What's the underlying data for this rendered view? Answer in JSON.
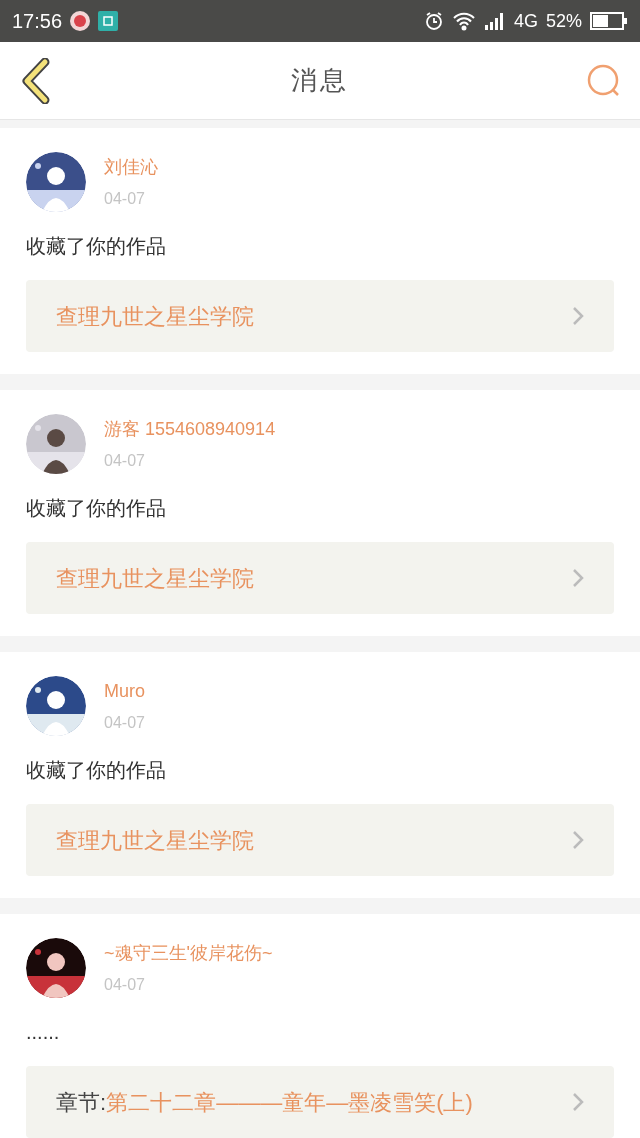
{
  "status_bar": {
    "time": "17:56",
    "network": "4G",
    "battery": "52%"
  },
  "header": {
    "title": "消息"
  },
  "messages": [
    {
      "user": "刘佳沁",
      "date": "04-07",
      "text": "收藏了你的作品",
      "link": {
        "title": "查理九世之星尘学院"
      }
    },
    {
      "user": "游客 1554608940914",
      "date": "04-07",
      "text": "收藏了你的作品",
      "link": {
        "title": "查理九世之星尘学院"
      }
    },
    {
      "user": "Muro",
      "date": "04-07",
      "text": "收藏了你的作品",
      "link": {
        "title": "查理九世之星尘学院"
      }
    },
    {
      "user": "~魂守三生'彼岸花伤~",
      "date": "04-07",
      "text": "......",
      "link": {
        "prefix": "章节:",
        "title": "第二十二章———童年—墨凌雪笑(上)"
      }
    }
  ]
}
